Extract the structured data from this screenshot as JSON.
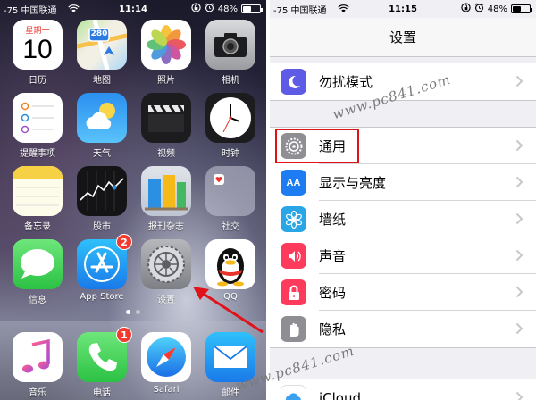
{
  "home": {
    "status": {
      "carrier": "-75 中国联通",
      "time": "11:14",
      "battery": "48%",
      "battery_level": 0.48
    },
    "apps": [
      {
        "id": "calendar",
        "label": "日历",
        "weekday": "星期一",
        "day": "10"
      },
      {
        "id": "maps",
        "label": "地图",
        "sign": "280"
      },
      {
        "id": "photos",
        "label": "照片"
      },
      {
        "id": "camera",
        "label": "相机"
      },
      {
        "id": "reminders",
        "label": "提醒事项"
      },
      {
        "id": "weather",
        "label": "天气"
      },
      {
        "id": "videos",
        "label": "视频"
      },
      {
        "id": "clock",
        "label": "时钟"
      },
      {
        "id": "notes",
        "label": "备忘录"
      },
      {
        "id": "stocks",
        "label": "股市"
      },
      {
        "id": "newsstand",
        "label": "报刊杂志"
      },
      {
        "id": "social",
        "label": "社交"
      },
      {
        "id": "messages",
        "label": "信息"
      },
      {
        "id": "appstore",
        "label": "App Store",
        "badge": "2"
      },
      {
        "id": "settings",
        "label": "设置"
      },
      {
        "id": "qq",
        "label": "QQ"
      }
    ],
    "dock": [
      {
        "id": "music",
        "label": "音乐"
      },
      {
        "id": "phone",
        "label": "电话",
        "badge": "1"
      },
      {
        "id": "safari",
        "label": "Safari"
      },
      {
        "id": "mail",
        "label": "邮件"
      }
    ]
  },
  "settings": {
    "status": {
      "carrier": "-75 中国联通",
      "time": "11:15",
      "battery": "48%",
      "battery_level": 0.48
    },
    "title": "设置",
    "rows": [
      {
        "id": "dnd",
        "label": "勿扰模式",
        "icon": "moon-icon",
        "color": "#5e5ce6"
      },
      {
        "id": "general",
        "label": "通用",
        "icon": "gear-icon",
        "color": "#8e8e93",
        "highlighted": true
      },
      {
        "id": "display",
        "label": "显示与亮度",
        "icon": "text-size-icon",
        "color": "#1e7cf2"
      },
      {
        "id": "wallpaper",
        "label": "墙纸",
        "icon": "flower-icon",
        "color": "#2aa6e6"
      },
      {
        "id": "sounds",
        "label": "声音",
        "icon": "speaker-icon",
        "color": "#fe3b5c"
      },
      {
        "id": "passcode",
        "label": "密码",
        "icon": "lock-icon",
        "color": "#fe3b5c"
      },
      {
        "id": "privacy",
        "label": "隐私",
        "icon": "hand-icon",
        "color": "#8e8e93"
      },
      {
        "id": "icloud",
        "label": "iCloud",
        "icon": "cloud-icon",
        "color": "#ffffff"
      }
    ]
  },
  "watermark": "www.pc841.com"
}
